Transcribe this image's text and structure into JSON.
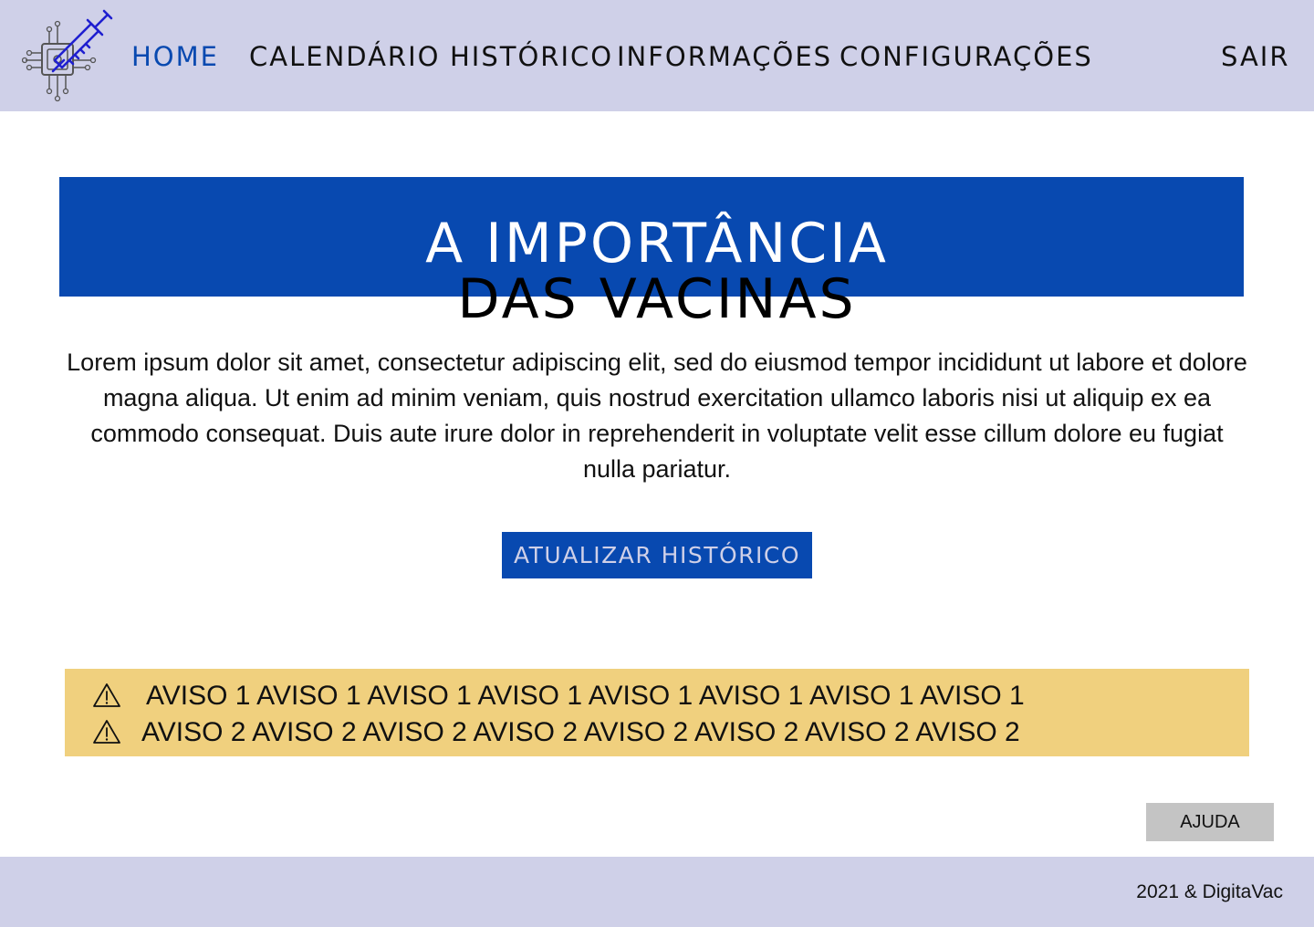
{
  "header": {
    "logo_icon": "syringe-chip-logo-icon",
    "nav": {
      "home": "HOME",
      "calendar": "CALENDÁRIO",
      "history": "HISTÓRICO",
      "info": "INFORMAÇÕES",
      "settings": "CONFIGURAÇÕES",
      "logout": "SAIR"
    },
    "active_item": "HOME"
  },
  "hero": {
    "title_line1": "A IMPORTÂNCIA",
    "title_line2": "DAS VACINAS",
    "body": "Lorem ipsum dolor sit amet, consectetur adipiscing elit, sed do eiusmod tempor incididunt ut labore et dolore magna aliqua. Ut enim ad minim veniam, quis nostrud exercitation ullamco laboris nisi ut aliquip ex ea commodo consequat. Duis aute irure dolor in reprehenderit in voluptate velit esse cillum dolore eu fugiat nulla pariatur.",
    "button": "ATUALIZAR HISTÓRICO"
  },
  "alerts": [
    {
      "icon": "warning-icon",
      "text": "AVISO 1  AVISO 1 AVISO 1 AVISO 1 AVISO 1 AVISO 1 AVISO 1 AVISO 1"
    },
    {
      "icon": "warning-icon",
      "text": "AVISO 2  AVISO 2 AVISO 2 AVISO 2 AVISO 2 AVISO 2 AVISO 2 AVISO 2"
    }
  ],
  "help_button": "AJUDA",
  "footer": {
    "copyright": "2021 & DigitaVac"
  },
  "colors": {
    "header_bg": "#cfd0e8",
    "accent_blue": "#0849b0",
    "alert_bg": "#f0d07e",
    "help_bg": "#c4c4c4"
  }
}
